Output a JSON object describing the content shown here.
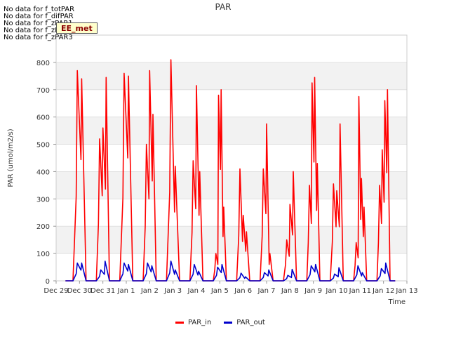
{
  "chart_data": {
    "type": "line",
    "title": "PAR",
    "xlabel": "Time",
    "ylabel": "PAR (umol/m2/s)",
    "xlim": [
      "Dec 29",
      "Jan 13"
    ],
    "ylim": [
      0,
      900
    ],
    "x_ticks": [
      "Dec 29",
      "Dec 30",
      "Dec 31",
      "Jan 1",
      "Jan 2",
      "Jan 3",
      "Jan 4",
      "Jan 5",
      "Jan 6",
      "Jan 7",
      "Jan 8",
      "Jan 9",
      "Jan 10",
      "Jan 11",
      "Jan 12",
      "Jan 13"
    ],
    "y_ticks": [
      0,
      100,
      200,
      300,
      400,
      500,
      600,
      700,
      800
    ],
    "grid": true,
    "legend_position": "bottom-center",
    "series": [
      {
        "name": "PAR_in",
        "color": "#ff0000",
        "daily_peaks": [
          {
            "day": "Dec 30",
            "peaks": [
              770,
              740
            ]
          },
          {
            "day": "Dec 31",
            "peaks": [
              520,
              560,
              745
            ]
          },
          {
            "day": "Jan 1",
            "peaks": [
              760,
              750
            ]
          },
          {
            "day": "Jan 2",
            "peaks": [
              500,
              770,
              610
            ]
          },
          {
            "day": "Jan 3",
            "peaks": [
              810,
              420
            ]
          },
          {
            "day": "Jan 4",
            "peaks": [
              440,
              715,
              400
            ]
          },
          {
            "day": "Jan 5",
            "peaks": [
              100,
              680,
              700,
              270
            ]
          },
          {
            "day": "Jan 6",
            "peaks": [
              410,
              240,
              180
            ]
          },
          {
            "day": "Jan 7",
            "peaks": [
              410,
              575,
              100
            ]
          },
          {
            "day": "Jan 8",
            "peaks": [
              150,
              280,
              400
            ]
          },
          {
            "day": "Jan 9",
            "peaks": [
              350,
              725,
              745,
              430
            ]
          },
          {
            "day": "Jan 10",
            "peaks": [
              355,
              330,
              575
            ]
          },
          {
            "day": "Jan 11",
            "peaks": [
              140,
              675,
              375,
              270
            ]
          },
          {
            "day": "Jan 12",
            "peaks": [
              350,
              480,
              660,
              700
            ]
          }
        ]
      },
      {
        "name": "PAR_out",
        "color": "#0000cc",
        "daily_peaks": [
          {
            "day": "Dec 30",
            "peaks": [
              65,
              65
            ]
          },
          {
            "day": "Dec 31",
            "peaks": [
              40,
              72
            ]
          },
          {
            "day": "Jan 1",
            "peaks": [
              65,
              60
            ]
          },
          {
            "day": "Jan 2",
            "peaks": [
              65,
              55
            ]
          },
          {
            "day": "Jan 3",
            "peaks": [
              72,
              40
            ]
          },
          {
            "day": "Jan 4",
            "peaks": [
              60,
              35
            ]
          },
          {
            "day": "Jan 5",
            "peaks": [
              50,
              60
            ]
          },
          {
            "day": "Jan 6",
            "peaks": [
              28,
              15
            ]
          },
          {
            "day": "Jan 7",
            "peaks": [
              30,
              40
            ]
          },
          {
            "day": "Jan 8",
            "peaks": [
              20,
              42
            ]
          },
          {
            "day": "Jan 9",
            "peaks": [
              55,
              60
            ]
          },
          {
            "day": "Jan 10",
            "peaks": [
              25,
              48
            ]
          },
          {
            "day": "Jan 11",
            "peaks": [
              55,
              30
            ]
          },
          {
            "day": "Jan 12",
            "peaks": [
              45,
              65
            ]
          }
        ]
      }
    ]
  },
  "notes": {
    "no_data_lines": [
      "No data for f_totPAR",
      "No data for f_difPAR",
      "No data for f_zPAR1",
      "No data for f_zPAR2",
      "No data for f_zPAR3"
    ],
    "badge": "EE_met"
  }
}
